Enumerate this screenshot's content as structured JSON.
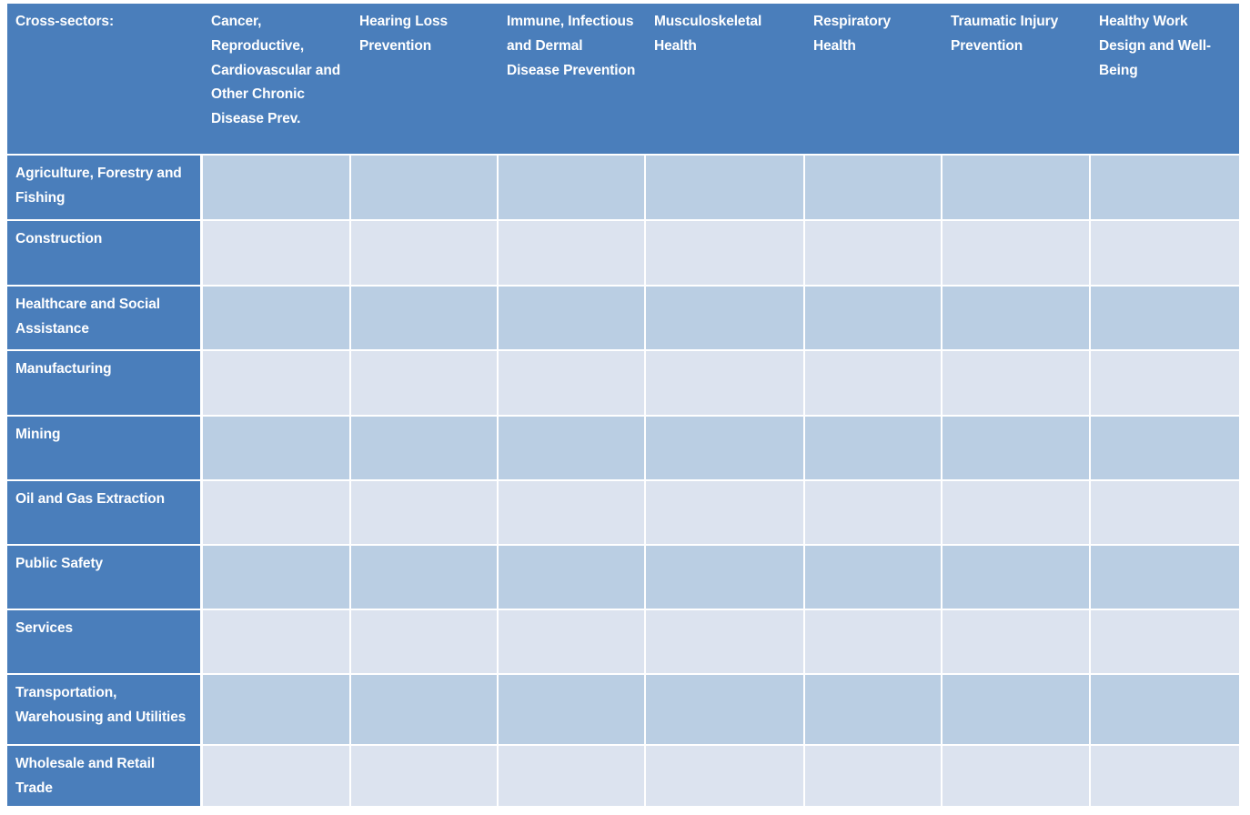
{
  "table": {
    "corner_label": "Cross-sectors:",
    "columns": [
      "Cancer, Reproductive, Cardiovascular and Other Chronic Disease Prev.",
      "Hearing Loss Prevention",
      "Immune, Infectious and Dermal Disease Prevention",
      "Musculoskeletal Health",
      "Respiratory Health",
      "Traumatic Injury Prevention",
      "Healthy Work Design and Well-Being"
    ],
    "rows": [
      {
        "label": "Agriculture, Forestry and Fishing",
        "cells": [
          "",
          "",
          "",
          "",
          "",
          "",
          ""
        ]
      },
      {
        "label": "Construction",
        "cells": [
          "",
          "",
          "",
          "",
          "",
          "",
          ""
        ]
      },
      {
        "label": "Healthcare and Social Assistance",
        "cells": [
          "",
          "",
          "",
          "",
          "",
          "",
          ""
        ]
      },
      {
        "label": "Manufacturing",
        "cells": [
          "",
          "",
          "",
          "",
          "",
          "",
          ""
        ]
      },
      {
        "label": "Mining",
        "cells": [
          "",
          "",
          "",
          "",
          "",
          "",
          ""
        ]
      },
      {
        "label": "Oil and Gas Extraction",
        "cells": [
          "",
          "",
          "",
          "",
          "",
          "",
          ""
        ]
      },
      {
        "label": "Public Safety",
        "cells": [
          "",
          "",
          "",
          "",
          "",
          "",
          ""
        ]
      },
      {
        "label": "Services",
        "cells": [
          "",
          "",
          "",
          "",
          "",
          "",
          ""
        ]
      },
      {
        "label": "Transportation, Warehousing and Utilities",
        "cells": [
          "",
          "",
          "",
          "",
          "",
          "",
          ""
        ]
      },
      {
        "label": "Wholesale and Retail Trade",
        "cells": [
          "",
          "",
          "",
          "",
          "",
          "",
          ""
        ]
      }
    ],
    "colors": {
      "header_blue": "#4a7ebb",
      "band_dark": "#bacee3",
      "band_light": "#dce3ef",
      "header_text": "#ffffff",
      "gridline": "#ffffff"
    }
  }
}
